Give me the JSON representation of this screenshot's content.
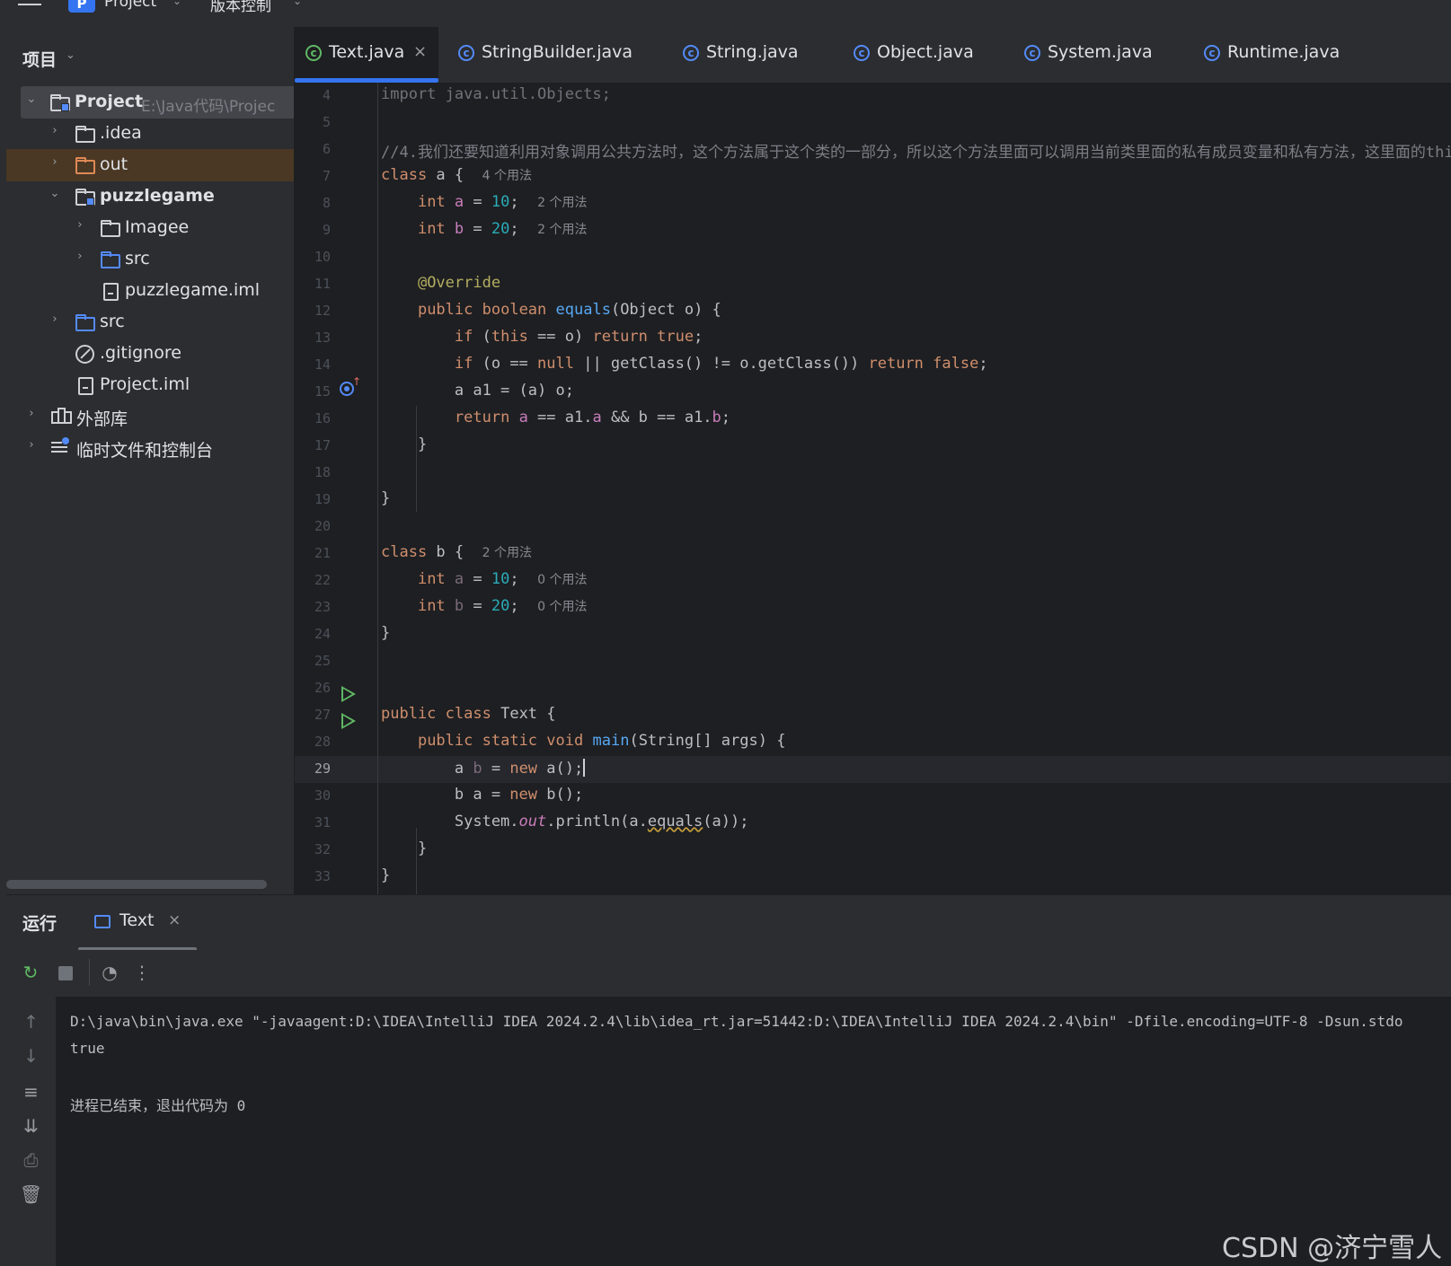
{
  "topbar": {
    "project_badge": "P",
    "project_name": "Project",
    "vcs_label": "版本控制"
  },
  "project_panel": {
    "title": "项目",
    "tree": [
      {
        "label": "Project",
        "path": "E:\\Java代码\\Projec",
        "icon": "module-folder-icon",
        "expanded": true
      },
      {
        "label": ".idea",
        "icon": "folder-icon",
        "expanded": false
      },
      {
        "label": "out",
        "icon": "folder-orange-icon",
        "expanded": false
      },
      {
        "label": "puzzlegame",
        "icon": "module-folder-icon",
        "expanded": true
      },
      {
        "label": "Imagee",
        "icon": "folder-icon",
        "expanded": false
      },
      {
        "label": "src",
        "icon": "source-folder-icon",
        "expanded": false
      },
      {
        "label": "puzzlegame.iml",
        "icon": "file-icon"
      },
      {
        "label": "src",
        "icon": "source-folder-icon",
        "expanded": false
      },
      {
        "label": ".gitignore",
        "icon": "ignore-file-icon"
      },
      {
        "label": "Project.iml",
        "icon": "file-icon"
      },
      {
        "label": "外部库",
        "icon": "library-icon",
        "expanded": false
      },
      {
        "label": "临时文件和控制台",
        "icon": "scratches-icon",
        "expanded": false
      }
    ]
  },
  "tabs": [
    {
      "label": "Text.java",
      "active": true,
      "icon": "class-icon"
    },
    {
      "label": "StringBuilder.java",
      "active": false,
      "icon": "class-icon"
    },
    {
      "label": "String.java",
      "active": false,
      "icon": "class-icon"
    },
    {
      "label": "Object.java",
      "active": false,
      "icon": "class-icon"
    },
    {
      "label": "System.java",
      "active": false,
      "icon": "class-icon"
    },
    {
      "label": "Runtime.java",
      "active": false,
      "icon": "class-icon"
    }
  ],
  "editor": {
    "current_line": "29",
    "lines": [
      {
        "n": "4",
        "code": "import java.util.Objects;"
      },
      {
        "n": "5",
        "code": ""
      },
      {
        "n": "6",
        "code": "//4.我们还要知道利用对象调用公共方法时，这个方法属于这个类的一部分，所以这个方法里面可以调用当前类里面的私有成员变量和私有方法，这里面的thi"
      },
      {
        "n": "7",
        "code": "class a {",
        "hint": "4 个用法"
      },
      {
        "n": "8",
        "code": "    int a = 10;",
        "hint": "2 个用法"
      },
      {
        "n": "9",
        "code": "    int b = 20;",
        "hint": "2 个用法"
      },
      {
        "n": "10",
        "code": ""
      },
      {
        "n": "11",
        "code": "    @Override"
      },
      {
        "n": "12",
        "code": "    public boolean equals(Object o) {"
      },
      {
        "n": "13",
        "code": "        if (this == o) return true;"
      },
      {
        "n": "14",
        "code": "        if (o == null || getClass() != o.getClass()) return false;"
      },
      {
        "n": "15",
        "code": "        a a1 = (a) o;"
      },
      {
        "n": "16",
        "code": "        return a == a1.a && b == a1.b;"
      },
      {
        "n": "17",
        "code": "    }"
      },
      {
        "n": "18",
        "code": ""
      },
      {
        "n": "19",
        "code": "}"
      },
      {
        "n": "20",
        "code": ""
      },
      {
        "n": "21",
        "code": "class b {",
        "hint": "2 个用法"
      },
      {
        "n": "22",
        "code": "    int a = 10;",
        "hint": "0 个用法"
      },
      {
        "n": "23",
        "code": "    int b = 20;",
        "hint": "0 个用法"
      },
      {
        "n": "24",
        "code": "}"
      },
      {
        "n": "25",
        "code": ""
      },
      {
        "n": "26",
        "code": ""
      },
      {
        "n": "27",
        "code": "public class Text {"
      },
      {
        "n": "28",
        "code": "    public static void main(String[] args) {"
      },
      {
        "n": "29",
        "code": "        a b = new a();"
      },
      {
        "n": "30",
        "code": "        b a = new b();"
      },
      {
        "n": "31",
        "code": "        System.out.println(a.equals(a));"
      },
      {
        "n": "32",
        "code": "    }"
      },
      {
        "n": "33",
        "code": "}"
      }
    ]
  },
  "run_panel": {
    "title": "运行",
    "tab_label": "Text",
    "console": [
      "D:\\java\\bin\\java.exe \"-javaagent:D:\\IDEA\\IntelliJ IDEA 2024.2.4\\lib\\idea_rt.jar=51442:D:\\IDEA\\IntelliJ IDEA 2024.2.4\\bin\" -Dfile.encoding=UTF-8 -Dsun.stdo",
      "true",
      "",
      "进程已结束，退出代码为 0"
    ]
  },
  "watermark": "CSDN @济宁雪人",
  "colors": {
    "accent": "#3574f0",
    "keyword": "#cf8e6d",
    "number": "#2aacb8",
    "field": "#c77dbb",
    "function": "#56a8f5",
    "annotation": "#b3ae60",
    "run_green": "#5fb865",
    "excluded_folder": "#e08855"
  }
}
